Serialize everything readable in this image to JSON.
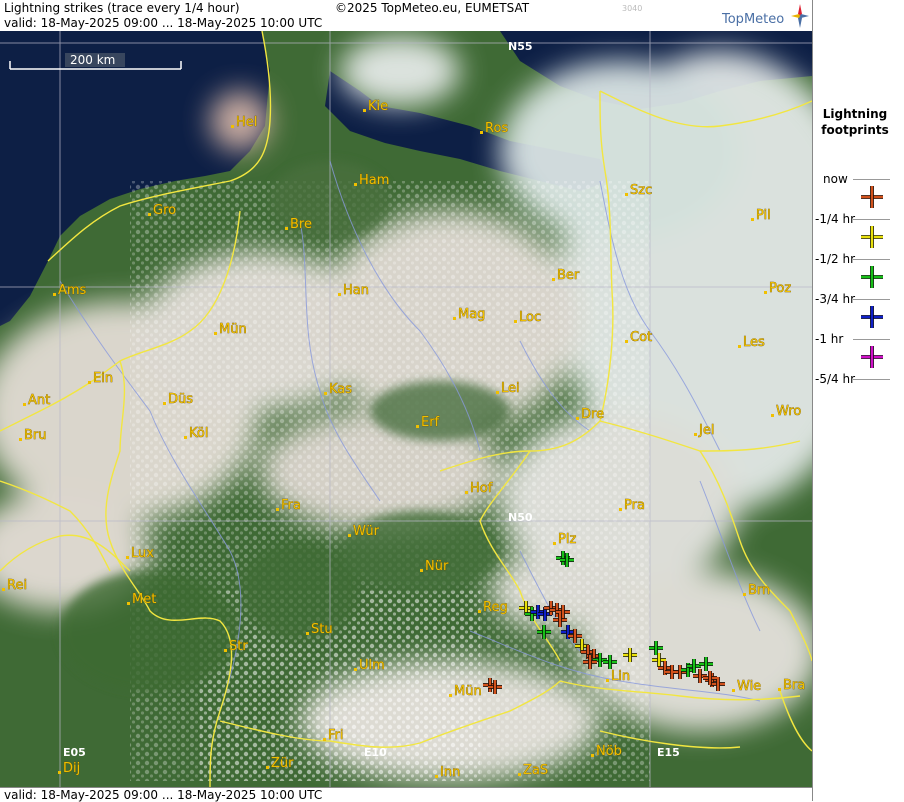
{
  "header": {
    "title": "Lightning strikes (trace every 1/4 hour)",
    "valid": "valid:  18-May-2025 09:00 ... 18-May-2025 10:00 UTC",
    "copyright": "©2025 TopMeteo.eu, EUMETSAT",
    "code": "3040",
    "logo": "TopMeteo"
  },
  "footer": {
    "valid": "valid:  18-May-2025 09:00 ... 18-May-2025 10:00 UTC"
  },
  "map": {
    "scale_label": "200 km",
    "coords": [
      "N55",
      "N50",
      "E05",
      "E10",
      "E15"
    ],
    "cities": [
      "Hel",
      "Kie",
      "Ros",
      "Ham",
      "Szc",
      "Gro",
      "Bre",
      "Pil",
      "Ams",
      "Han",
      "Ber",
      "Poz",
      "Mün",
      "Mag",
      "Loc",
      "Cot",
      "Les",
      "Ein",
      "Kas",
      "Lei",
      "Ant",
      "Düs",
      "Wro",
      "Bru",
      "Köl",
      "Erf",
      "Dre",
      "Jel",
      "Hof",
      "Fra",
      "Pra",
      "Wür",
      "Plz",
      "Lux",
      "Nür",
      "Rei",
      "Met",
      "Reg",
      "Brn",
      "Stu",
      "Str",
      "Ulm",
      "Lin",
      "Mün",
      "Wie",
      "Bra",
      "Fri",
      "Dij",
      "Zür",
      "Inn",
      "ZaS",
      "Nöb"
    ],
    "colors": {
      "sea": "#0d1f45",
      "land": "#3f6a35",
      "cloud": "#e8e2dc",
      "border": "#f2e640",
      "river": "#8899dd",
      "city": "#f0c000"
    }
  },
  "legend": {
    "title_line1": "Lightning",
    "title_line2": "footprints",
    "items": [
      {
        "label": "now",
        "color": "#d2521c",
        "icon": "cross-icon"
      },
      {
        "label": "-1/4 hr",
        "color": "#e8e00c",
        "icon": "cross-icon"
      },
      {
        "label": "-1/2 hr",
        "color": "#18c018",
        "icon": "cross-icon"
      },
      {
        "label": "-3/4 hr",
        "color": "#1020c8",
        "icon": "cross-icon"
      },
      {
        "label": "-1 hr",
        "color": "#d010c8",
        "icon": "cross-icon"
      },
      {
        "label": "-5/4 hr",
        "color": "",
        "icon": ""
      }
    ]
  }
}
